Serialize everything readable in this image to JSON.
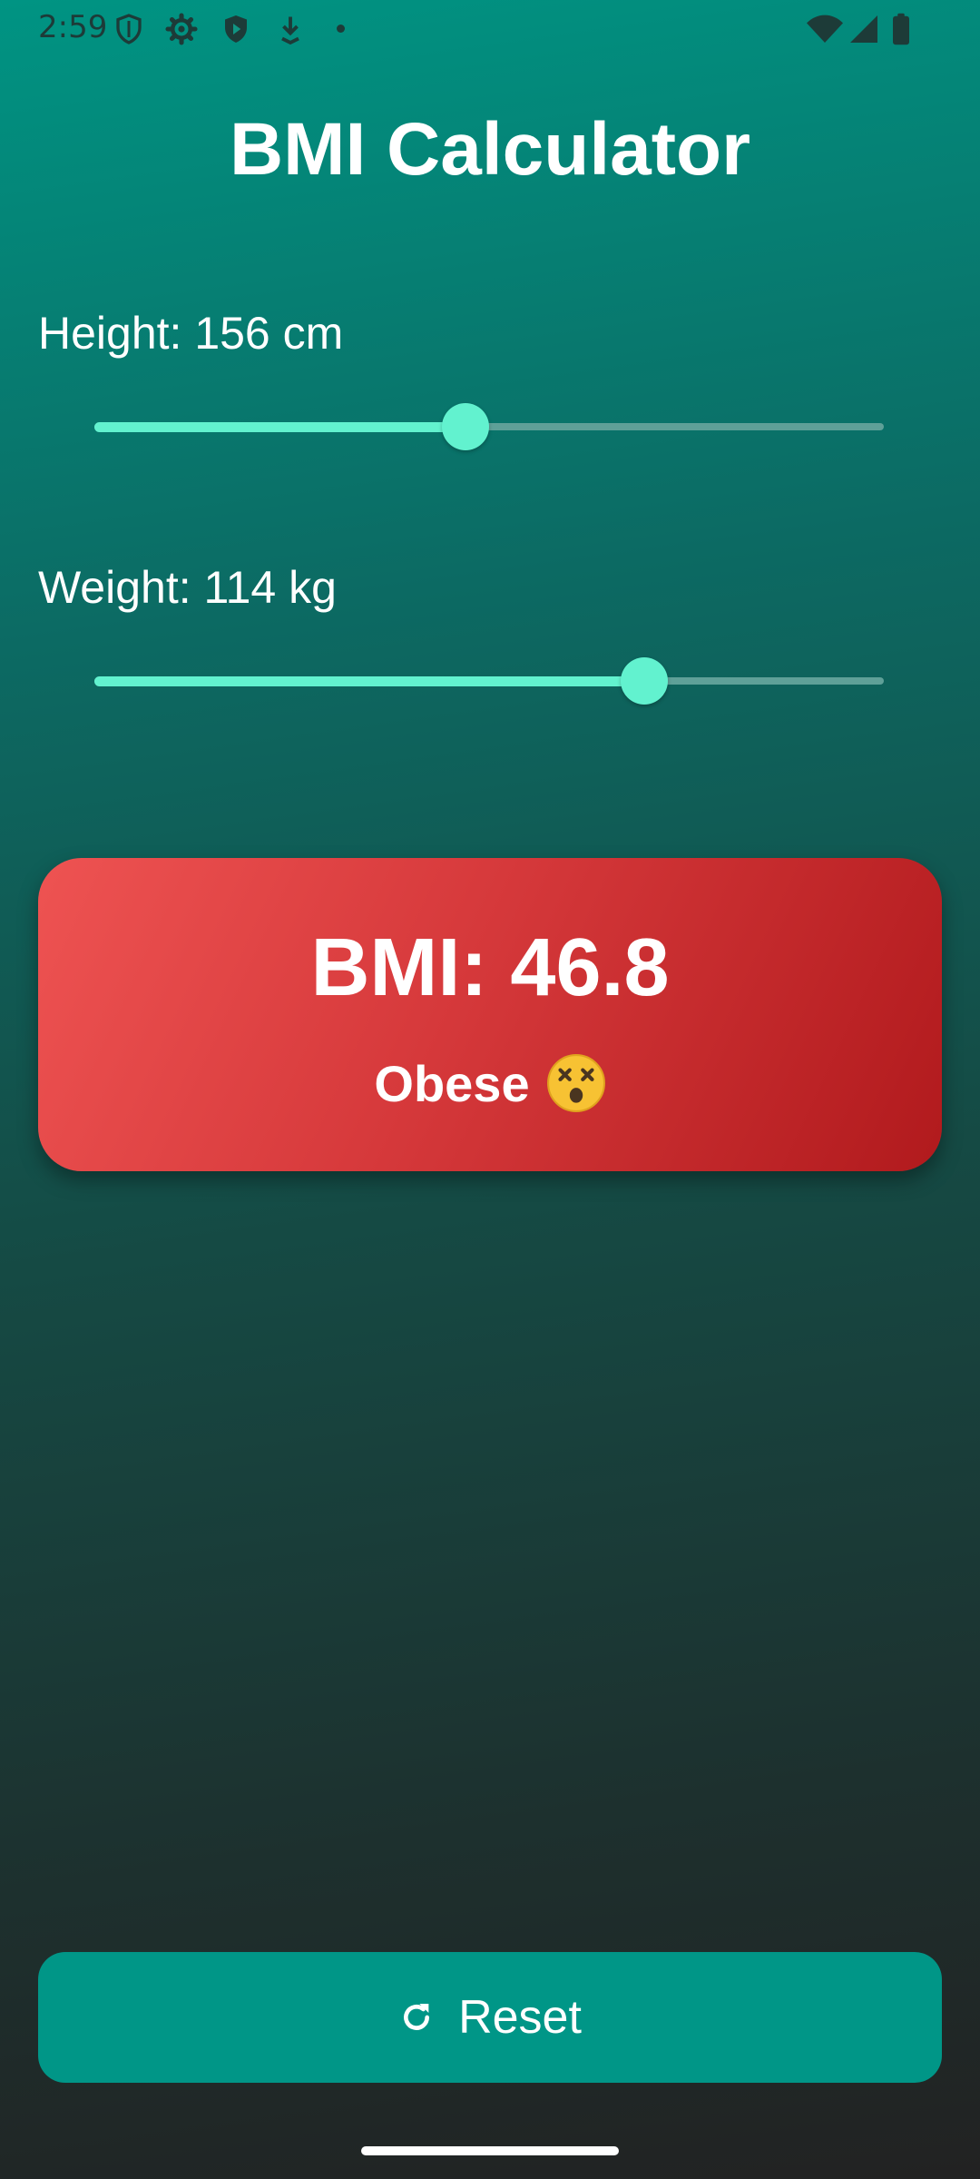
{
  "status_bar": {
    "time": "2:59",
    "icons": [
      "shield-outline-icon",
      "gear-icon",
      "shield-play-icon",
      "download-arrow-icon",
      "dot-icon",
      "wifi-icon",
      "signal-icon",
      "battery-icon"
    ],
    "icon_color": "#1d3b38"
  },
  "title": "BMI Calculator",
  "height": {
    "label": "Height: 156 cm",
    "slider_fraction": 0.47
  },
  "weight": {
    "label": "Weight: 114 kg",
    "slider_fraction": 0.696
  },
  "result": {
    "bmi_text": "BMI: 46.8",
    "category": "Obese",
    "emoji": "dizzy-face-icon",
    "card_color": "#d6393b"
  },
  "reset": {
    "label": "Reset",
    "icon": "refresh-icon",
    "color": "#009687"
  },
  "colors": {
    "accent": "#62f2cf",
    "track": "#5fa098"
  }
}
